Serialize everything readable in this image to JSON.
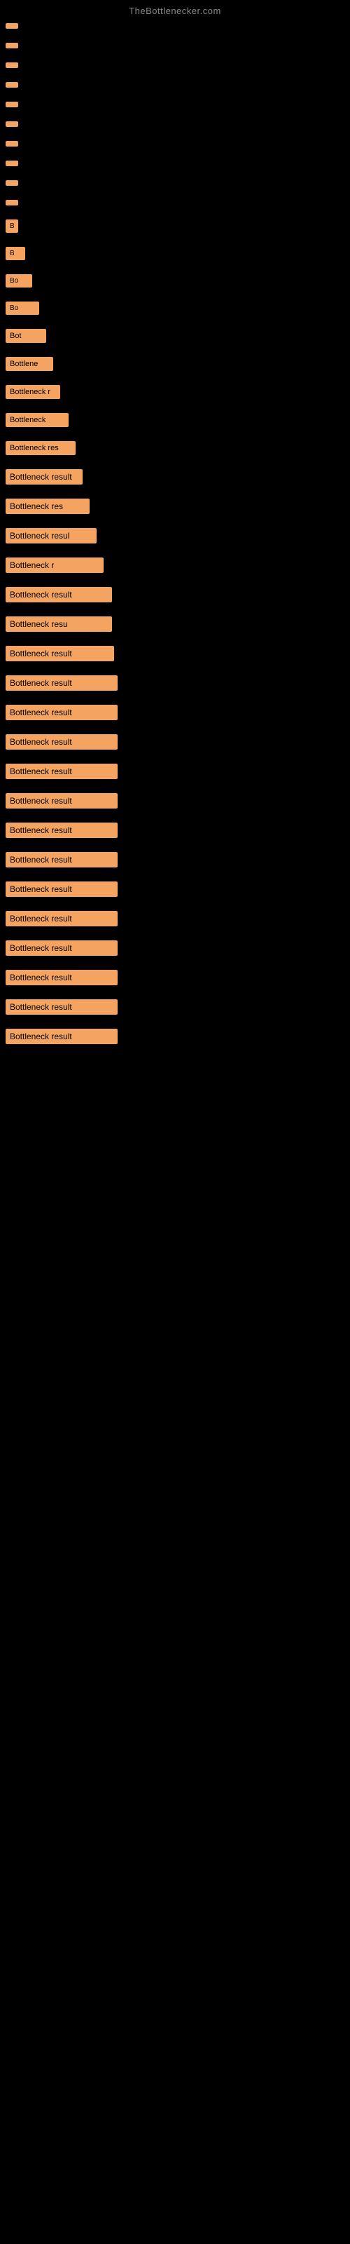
{
  "site": {
    "title": "TheBottlenecker.com"
  },
  "items": [
    {
      "label": "",
      "width_class": "w-tiny"
    },
    {
      "label": "",
      "width_class": "w-tiny"
    },
    {
      "label": "",
      "width_class": "w-tiny"
    },
    {
      "label": "",
      "width_class": "w-tiny"
    },
    {
      "label": "",
      "width_class": "w-tiny"
    },
    {
      "label": "",
      "width_class": "w-tiny"
    },
    {
      "label": "",
      "width_class": "w-tiny"
    },
    {
      "label": "",
      "width_class": "w-tiny"
    },
    {
      "label": "",
      "width_class": "w-tiny"
    },
    {
      "label": "",
      "width_class": "w-tiny"
    },
    {
      "label": "B",
      "width_class": "w-tiny"
    },
    {
      "label": "B",
      "width_class": "w-xs"
    },
    {
      "label": "Bo",
      "width_class": "w-sm"
    },
    {
      "label": "Bo",
      "width_class": "w-sm2"
    },
    {
      "label": "Bot",
      "width_class": "w-sm3"
    },
    {
      "label": "Bottlene",
      "width_class": "w-md0"
    },
    {
      "label": "Bottleneck r",
      "width_class": "w-md"
    },
    {
      "label": "Bottleneck",
      "width_class": "w-md2"
    },
    {
      "label": "Bottleneck res",
      "width_class": "w-md3"
    },
    {
      "label": "Bottleneck result",
      "width_class": "w-lg0"
    },
    {
      "label": "Bottleneck res",
      "width_class": "w-lg"
    },
    {
      "label": "Bottleneck resul",
      "width_class": "w-lg2"
    },
    {
      "label": "Bottleneck r",
      "width_class": "w-lg3"
    },
    {
      "label": "Bottleneck result",
      "width_class": "w-full"
    },
    {
      "label": "Bottleneck resu",
      "width_class": "w-full"
    },
    {
      "label": "Bottleneck result",
      "width_class": "w-full2"
    },
    {
      "label": "Bottleneck result",
      "width_class": "w-full3"
    },
    {
      "label": "Bottleneck result",
      "width_class": "w-full3"
    },
    {
      "label": "Bottleneck result",
      "width_class": "w-full3"
    },
    {
      "label": "Bottleneck result",
      "width_class": "w-full3"
    },
    {
      "label": "Bottleneck result",
      "width_class": "w-full3"
    },
    {
      "label": "Bottleneck result",
      "width_class": "w-full3"
    },
    {
      "label": "Bottleneck result",
      "width_class": "w-full3"
    },
    {
      "label": "Bottleneck result",
      "width_class": "w-full3"
    },
    {
      "label": "Bottleneck result",
      "width_class": "w-full3"
    },
    {
      "label": "Bottleneck result",
      "width_class": "w-full3"
    },
    {
      "label": "Bottleneck result",
      "width_class": "w-full3"
    },
    {
      "label": "Bottleneck result",
      "width_class": "w-full3"
    },
    {
      "label": "Bottleneck result",
      "width_class": "w-full3"
    }
  ]
}
